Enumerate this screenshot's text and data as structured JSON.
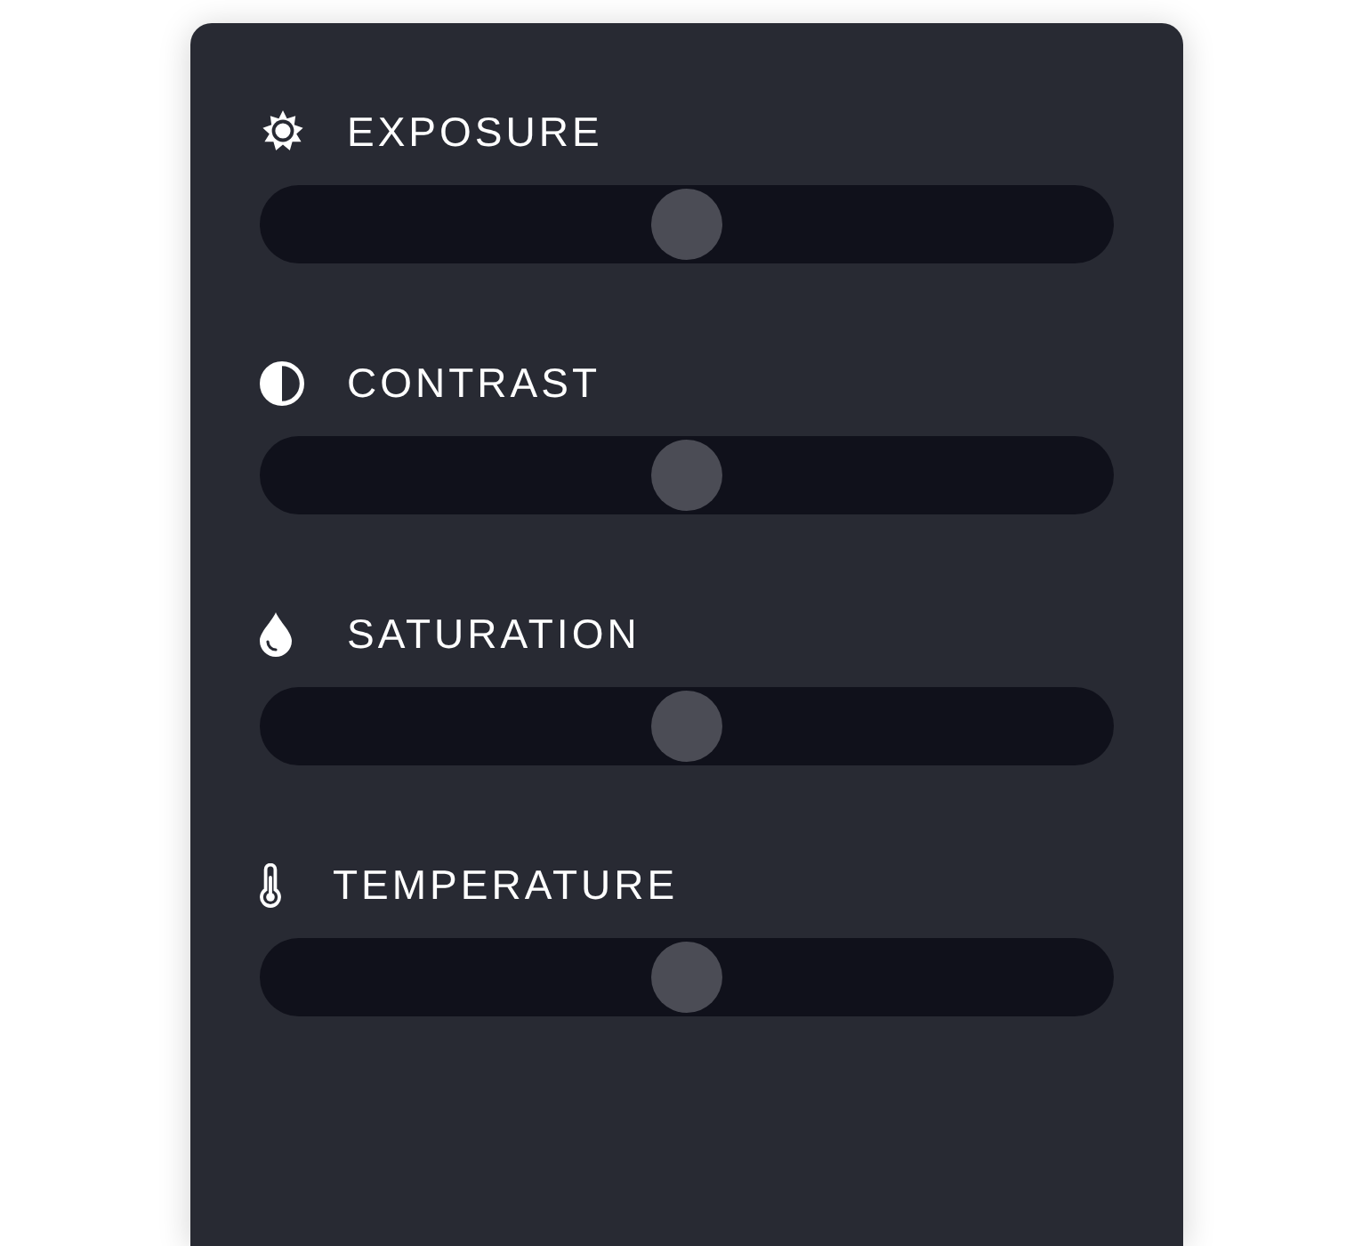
{
  "panel": {
    "adjustments": [
      {
        "kind": "exposure",
        "label": "EXPOSURE",
        "level": 0.5
      },
      {
        "kind": "contrast",
        "label": "CONTRAST",
        "level": 0.5
      },
      {
        "kind": "saturation",
        "label": "SATURATION",
        "level": 0.5
      },
      {
        "kind": "temperature",
        "label": "TEMPERATURE",
        "level": 0.5
      }
    ]
  }
}
